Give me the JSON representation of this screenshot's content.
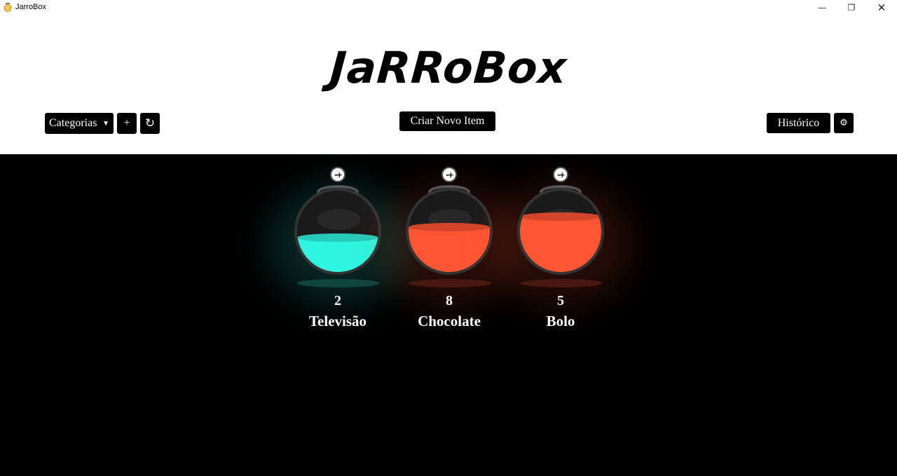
{
  "window": {
    "title": "JarroBox",
    "icon": "jar-icon",
    "controls": {
      "minimize": "—",
      "maximize": "❐",
      "close": "✕"
    }
  },
  "header": {
    "logo": "JaRRoBox",
    "categories_label": "Categorias",
    "add_label": "+",
    "refresh_label": "↻",
    "new_item_label": "Criar Novo Item",
    "history_label": "Histórico",
    "settings_label": "⚙"
  },
  "jars": [
    {
      "name": "Televisão",
      "count": "2",
      "color": "#2ef5e0",
      "fill": 0.42,
      "control": "-+"
    },
    {
      "name": "Chocolate",
      "count": "8",
      "color": "#ff5533",
      "fill": 0.55,
      "control": "-+"
    },
    {
      "name": "Bolo",
      "count": "5",
      "color": "#ff5533",
      "fill": 0.68,
      "control": "-+"
    }
  ],
  "colors": {
    "header_bg": "#ffffff",
    "stage_bg": "#000000",
    "button_bg": "#000000",
    "button_text": "#ffffff"
  }
}
